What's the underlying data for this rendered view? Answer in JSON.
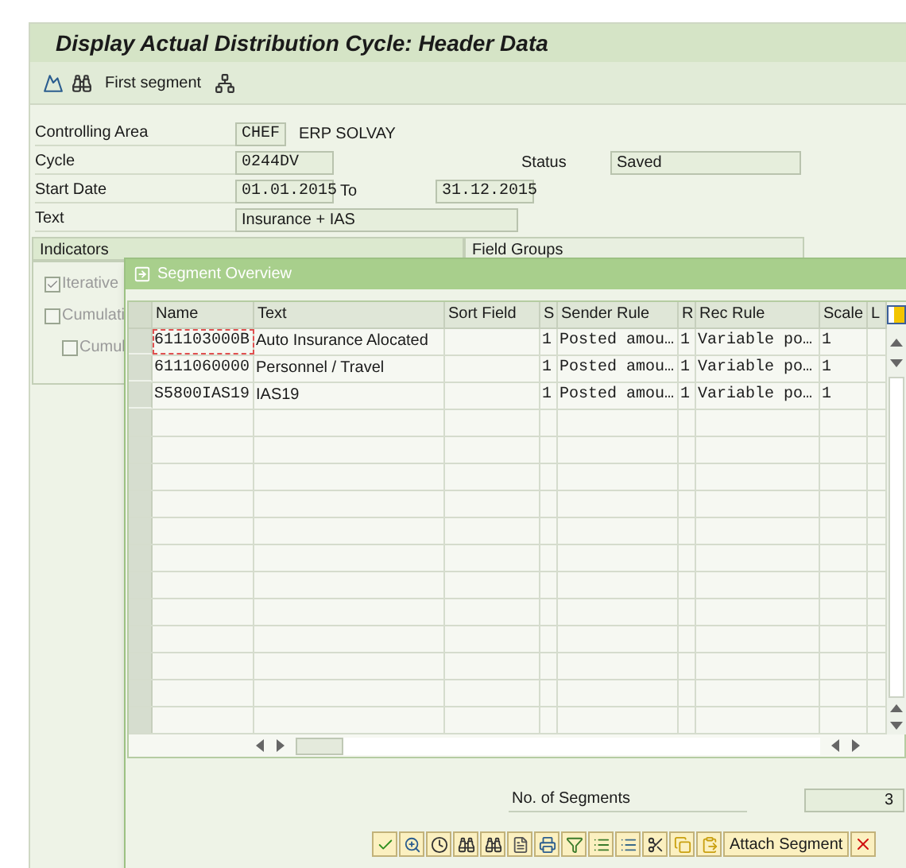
{
  "window": {
    "title": "Display Actual Distribution Cycle: Header Data"
  },
  "toolbar": {
    "button": "First segment"
  },
  "form": [
    {
      "label": "Controlling Area",
      "value": "CHEF",
      "extra": "ERP SOLVAY",
      "kind": "short"
    },
    {
      "label": "Cycle",
      "value": "0244DV",
      "status_label": "Status",
      "status": "Saved",
      "kind": "status"
    },
    {
      "label": "Start Date",
      "value": "01.01.2015",
      "to_label": "To",
      "to": "31.12.2015",
      "kind": "range"
    },
    {
      "label": "Text",
      "value": "Insurance + IAS",
      "kind": "wide"
    }
  ],
  "tabs": [
    {
      "label": "Indicators",
      "selected": true
    },
    {
      "label": "Field Groups",
      "selected": false
    }
  ],
  "indicators": [
    {
      "label": "Iterative",
      "checked": true,
      "nested": false
    },
    {
      "label": "Cumulati",
      "checked": false,
      "nested": false
    },
    {
      "label": "Cumul",
      "checked": false,
      "nested": true
    }
  ],
  "dialog": {
    "title": "Segment Overview",
    "table": {
      "columns": [
        "Name",
        "Text",
        "Sort Field",
        "S",
        "Sender Rule",
        "R",
        "Rec Rule",
        "Scale",
        "L"
      ],
      "rows": [
        {
          "focused": true,
          "cells": [
            "611103000B",
            "Auto Insurance Alocated",
            "",
            "1",
            "Posted amou…",
            "1",
            "Variable po…",
            "1",
            ""
          ]
        },
        {
          "focused": false,
          "cells": [
            "6111060000",
            "Personnel / Travel",
            "",
            "1",
            "Posted amou…",
            "1",
            "Variable po…",
            "1",
            ""
          ]
        },
        {
          "focused": false,
          "cells": [
            "S5800IAS19",
            "IAS19",
            "",
            "1",
            "Posted amou…",
            "1",
            "Variable po…",
            "1",
            ""
          ]
        }
      ]
    },
    "count_label": "No. of Segments",
    "count": "3",
    "attach_button": "Attach Segment"
  }
}
